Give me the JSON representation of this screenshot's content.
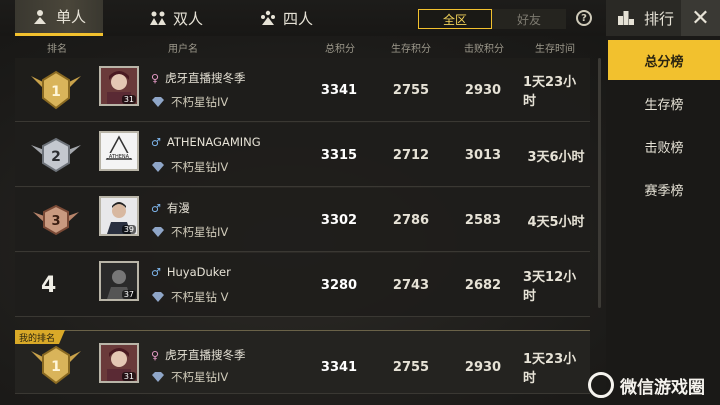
{
  "tabs": [
    {
      "label": "单人",
      "active": true
    },
    {
      "label": "双人",
      "active": false
    },
    {
      "label": "四人",
      "active": false
    }
  ],
  "scope": {
    "all": "全区",
    "friends": "好友"
  },
  "help_icon": "question-icon",
  "panel": {
    "title": "排行",
    "close": "✕",
    "menu": [
      "总分榜",
      "生存榜",
      "击败榜",
      "赛季榜"
    ]
  },
  "columns": {
    "rank": "排名",
    "user": "用户名",
    "total": "总积分",
    "survival": "生存积分",
    "kills": "击败积分",
    "time": "生存时间"
  },
  "rows": [
    {
      "rank": "1",
      "badge": "gold-rank-badge",
      "gender": "♀",
      "name": "虎牙直播搜冬季",
      "tier": "不朽星钻IV",
      "level": "31",
      "total": "3341",
      "survival": "2755",
      "kills": "2930",
      "time": "1天23小时"
    },
    {
      "rank": "2",
      "badge": "silver-rank-badge",
      "gender": "♂",
      "name": "ATHENAGAMING",
      "tier": "不朽星钻IV",
      "level": "",
      "total": "3315",
      "survival": "2712",
      "kills": "3013",
      "time": "3天6小时"
    },
    {
      "rank": "3",
      "badge": "bronze-rank-badge",
      "gender": "♂",
      "name": "有漫",
      "tier": "不朽星钻IV",
      "level": "39",
      "total": "3302",
      "survival": "2786",
      "kills": "2583",
      "time": "4天5小时"
    },
    {
      "rank": "4",
      "badge": "",
      "gender": "♂",
      "name": "HuyaDuker",
      "tier": "不朽星钻 V",
      "level": "37",
      "total": "3280",
      "survival": "2743",
      "kills": "2682",
      "time": "3天12小时"
    }
  ],
  "my_rank": {
    "tag": "我的排名",
    "rank": "1",
    "gender": "♀",
    "name": "虎牙直播搜冬季",
    "tier": "不朽星钻IV",
    "level": "31",
    "total": "3341",
    "survival": "2755",
    "kills": "2930",
    "time": "1天23小时"
  },
  "watermark": "微信游戏圈",
  "colors": {
    "accent": "#f2c12e",
    "bg": "#1c1b19"
  }
}
